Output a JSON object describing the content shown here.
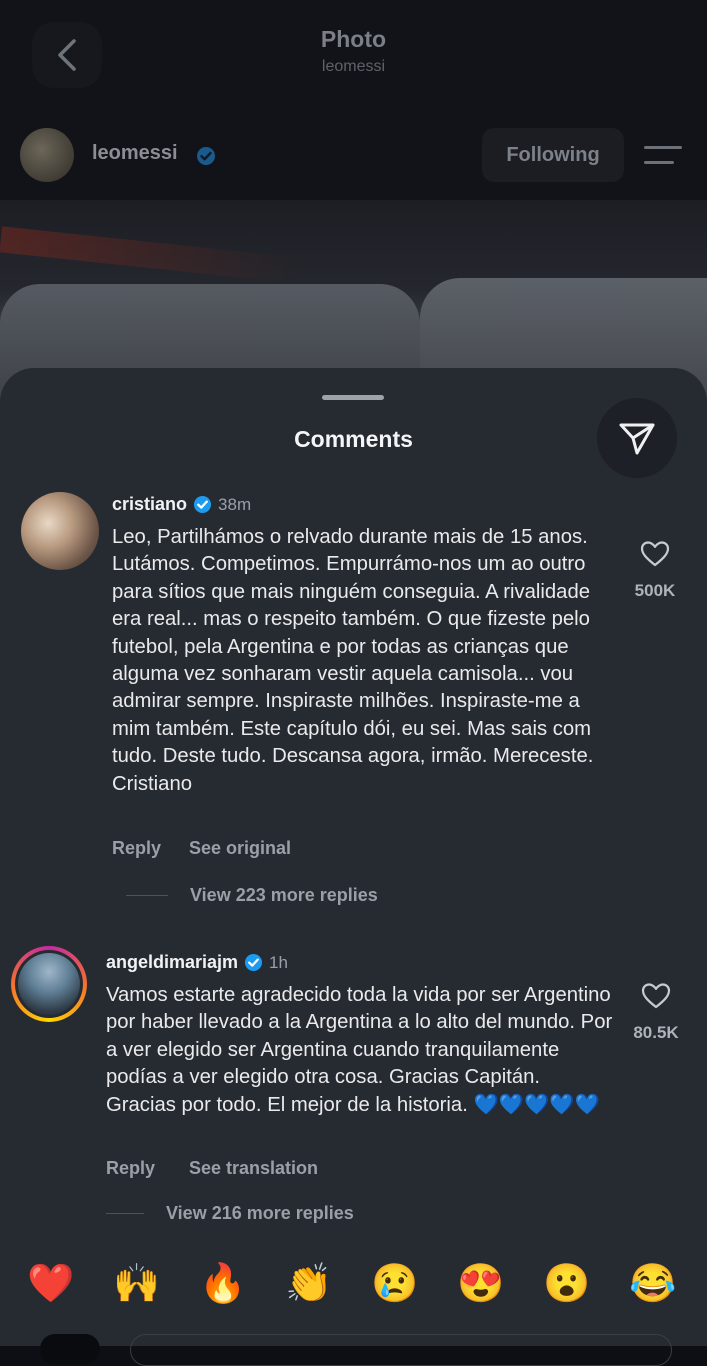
{
  "header": {
    "title": "Photo",
    "subtitle": "leomessi"
  },
  "post": {
    "owner": "leomessi",
    "follow_label": "Following"
  },
  "sheet": {
    "title": "Comments"
  },
  "comments": [
    {
      "username": "cristiano",
      "time": "38m",
      "text": "Leo, Partilhámos o relvado durante mais de 15 anos. Lutámos. Competimos. Empurrámo-nos um ao outro para sítios que mais ninguém conseguia. A rivalidade era real... mas o respeito também. O que fizeste pelo futebol, pela Argentina e por todas as crianças que alguma vez sonharam vestir aquela camisola... vou admirar sempre. Inspiraste milhões. Inspiraste-me a mim também. Este capítulo dói, eu sei. Mas sais com tudo. Deste tudo. Descansa agora, irmão. Mereceste. Cristiano",
      "likes": "500K",
      "reply_label": "Reply",
      "secondary_label": "See original",
      "more_replies": "View 223 more replies"
    },
    {
      "username": "angeldimariajm",
      "time": "1h",
      "text": "Vamos estarte agradecido toda la vida por ser Argentino por haber llevado a la Argentina a lo alto del mundo. Por a ver elegido ser Argentina cuando tranquilamente podías a ver elegido otra cosa. Gracias Capitán. Gracias por todo. El mejor de la historia. 💙💙💙💙💙",
      "likes": "80.5K",
      "reply_label": "Reply",
      "secondary_label": "See translation",
      "more_replies": "View 216 more replies"
    }
  ],
  "quick_reactions": [
    "❤️",
    "🙌",
    "🔥",
    "👏",
    "😢",
    "😍",
    "😮",
    "😂"
  ],
  "colors": {
    "verified": "#1d9bf0",
    "sheet_bg": "#262a31",
    "page_bg": "#0d0f14"
  }
}
